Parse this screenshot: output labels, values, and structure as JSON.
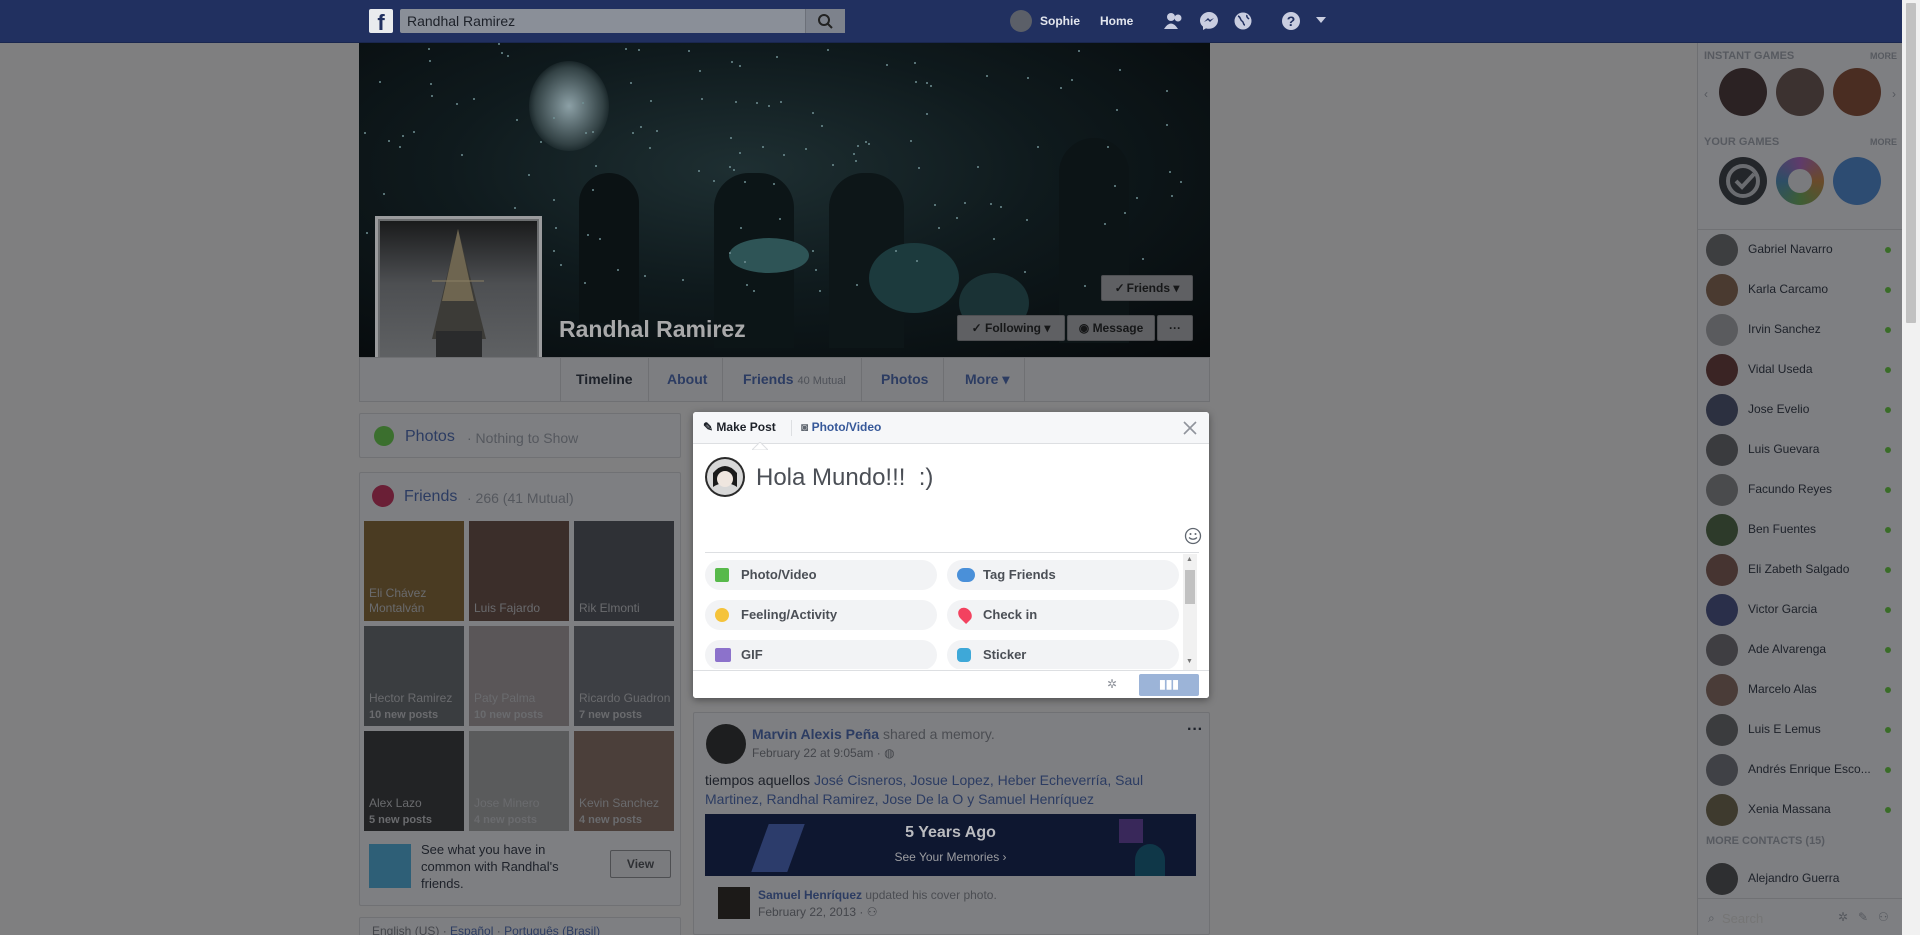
{
  "topbar": {
    "search_value": "Randhal Ramirez",
    "user_name": "Sophie",
    "home_label": "Home"
  },
  "profile": {
    "name": "Randhal Ramirez",
    "friends_button": "Friends",
    "following_button": "Following",
    "message_button": "Message",
    "more_button": "···"
  },
  "tabs": [
    {
      "label": "Timeline"
    },
    {
      "label": "About"
    },
    {
      "label": "Friends",
      "sub": "40 Mutual"
    },
    {
      "label": "Photos"
    },
    {
      "label": "More"
    }
  ],
  "photos_card": {
    "title": "Photos",
    "sub": "· Nothing to Show"
  },
  "friends_card": {
    "title": "Friends",
    "sub": "· 266 (41 Mutual)",
    "friends": [
      {
        "name": "Eli Chávez Montalván",
        "sub": ""
      },
      {
        "name": "Luis Fajardo",
        "sub": ""
      },
      {
        "name": "Rik Elmonti",
        "sub": ""
      },
      {
        "name": "Hector Ramirez",
        "sub": "10 new posts"
      },
      {
        "name": "Paty Palma",
        "sub": "10 new posts"
      },
      {
        "name": "Ricardo Guadron",
        "sub": "7 new posts"
      },
      {
        "name": "Alex Lazo",
        "sub": "5 new posts"
      },
      {
        "name": "Jose Minero",
        "sub": "4 new posts"
      },
      {
        "name": "Kevin Sanchez",
        "sub": "4 new posts"
      }
    ],
    "common_text": "See what you have in common with Randhal's friends.",
    "view_button": "View"
  },
  "footer": {
    "lang1": "English (US)",
    "lang2": "Español",
    "lang3": "Português (Brasil)"
  },
  "composer": {
    "make_post": "Make Post",
    "photo_video_tab": "Photo/Video",
    "text": "Hola Mundo!!!  :)",
    "options": [
      {
        "label": "Photo/Video",
        "icon": "photo-icon",
        "color": "#58b94b"
      },
      {
        "label": "Tag Friends",
        "icon": "tag-friends-icon",
        "color": "#4a90d9"
      },
      {
        "label": "Feeling/Activity",
        "icon": "feeling-icon",
        "color": "#f5c33b"
      },
      {
        "label": "Check in",
        "icon": "check-in-icon",
        "color": "#f3425f"
      },
      {
        "label": "GIF",
        "icon": "gif-icon",
        "color": "#8c72cb"
      },
      {
        "label": "Sticker",
        "icon": "sticker-icon",
        "color": "#3ea8d8"
      }
    ]
  },
  "post": {
    "author": "Marvin Alexis Peña",
    "action": "shared a memory.",
    "date": "February 22 at 9:05am",
    "text_prefix": "tiempos aquellos ",
    "tags": "José Cisneros, Josue Lopez, Heber Echeverría, Saul Martinez, Randhal Ramirez, Jose De la O y Samuel Henríquez",
    "memory_title": "5 Years Ago",
    "memory_link": "See Your Memories ›",
    "inner_author": "Samuel Henríquez",
    "inner_action": "updated his cover photo.",
    "inner_date": "February 22, 2013"
  },
  "rail": {
    "instant_games": "INSTANT GAMES",
    "your_games": "YOUR GAMES",
    "more": "MORE",
    "contacts": [
      "Gabriel Navarro",
      "Karla Carcamo",
      "Irvin Sanchez",
      "Vidal Useda",
      "Jose Evelio",
      "Luis Guevara",
      "Facundo Reyes",
      "Ben Fuentes",
      "Eli Zabeth Salgado",
      "Victor Garcia",
      "Ade Alvarenga",
      "Marcelo Alas",
      "Luis E Lemus",
      "Andrés Enrique Esco...",
      "Xenia Massana"
    ],
    "more_contacts": "MORE CONTACTS (15)",
    "extra_contact": "Alejandro Guerra",
    "search_placeholder": "Search"
  }
}
